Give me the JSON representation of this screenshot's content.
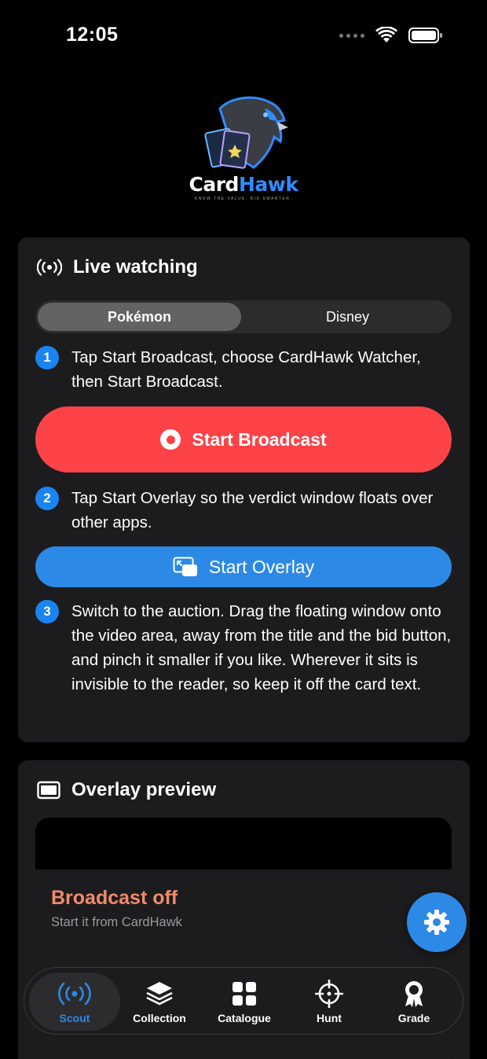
{
  "status_bar": {
    "time": "12:05"
  },
  "logo": {
    "word_part1": "Card",
    "word_part2": "Hawk",
    "tagline": "KNOW THE VALUE. BID SMARTER."
  },
  "live_watching": {
    "title": "Live watching",
    "segments": [
      "Pokémon",
      "Disney"
    ],
    "selected_segment": "Pokémon",
    "steps": [
      {
        "number": "1",
        "text": "Tap Start Broadcast, choose CardHawk Watcher, then Start Broadcast."
      },
      {
        "number": "2",
        "text": "Tap Start Overlay so the verdict window floats over other apps."
      },
      {
        "number": "3",
        "text": "Switch to the auction. Drag the floating window onto the video area, away from the title and the bid button, and pinch it smaller if you like. Wherever it sits is invisible to the reader, so keep it off the card text."
      }
    ],
    "broadcast_button": "Start Broadcast",
    "overlay_button": "Start Overlay"
  },
  "overlay_preview": {
    "title": "Overlay preview",
    "status_title": "Broadcast off",
    "status_subtitle": "Start it from CardHawk"
  },
  "tab_bar": {
    "tabs": [
      {
        "label": "Scout",
        "icon": "broadcast-icon",
        "active": true
      },
      {
        "label": "Collection",
        "icon": "layers-icon",
        "active": false
      },
      {
        "label": "Catalogue",
        "icon": "grid-icon",
        "active": false
      },
      {
        "label": "Hunt",
        "icon": "crosshair-icon",
        "active": false
      },
      {
        "label": "Grade",
        "icon": "award-icon",
        "active": false
      }
    ]
  },
  "colors": {
    "accent_blue": "#2d89e6",
    "broadcast_red": "#fd4348",
    "status_orange": "#f28a6a",
    "card_bg": "#1c1c1e"
  }
}
